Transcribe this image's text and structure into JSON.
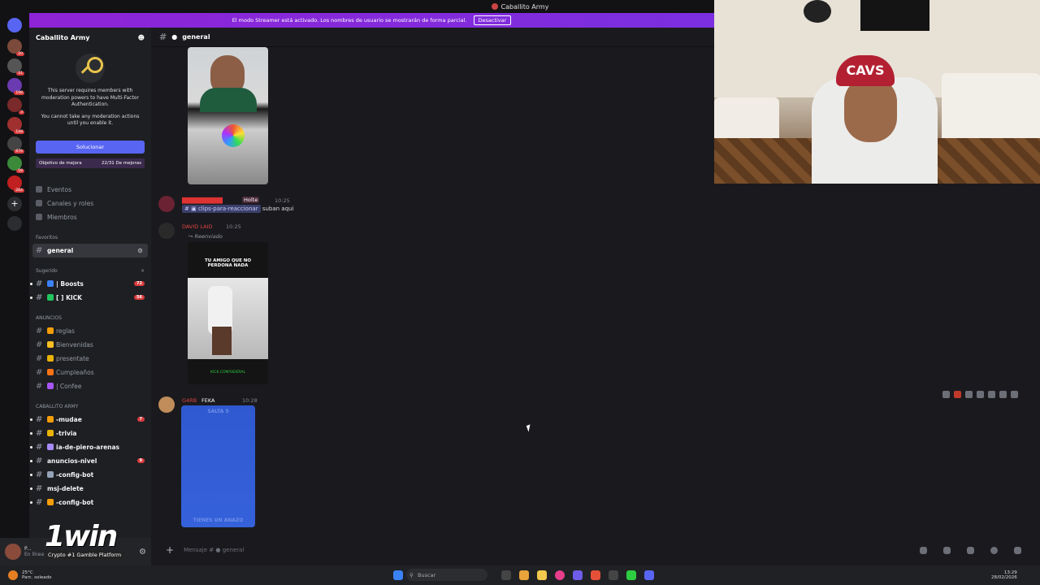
{
  "window": {
    "title": "Caballito Army"
  },
  "streamer_banner": {
    "text": "El modo Streamer está activado. Los nombres de usuario se mostrarán de forma parcial.",
    "button": "Desactivar"
  },
  "server_rail": [
    {
      "badge": "20"
    },
    {
      "badge": "41"
    },
    {
      "badge": "198"
    },
    {
      "badge": "3"
    },
    {
      "badge": "148"
    },
    {
      "badge": "676"
    },
    {
      "badge": "58"
    },
    {
      "badge": "264"
    }
  ],
  "sidebar": {
    "server_name": "Caballito Army",
    "mfa_text1": "This server requires members with moderation powers to have Multi-Factor Authentication.",
    "mfa_text2": "You cannot take any moderation actions until you enable it.",
    "solve_button": "Solucionar",
    "boost_label": "Objetivo de mejora",
    "boost_progress": "22/31 De mejoras",
    "nav": [
      "Eventos",
      "Canales y roles",
      "Miembros"
    ],
    "favorites_label": "Favoritos",
    "active_channel": "general",
    "suggested_label": "Sugerido",
    "suggested": [
      {
        "name": "| Boosts",
        "count": "72"
      },
      {
        "name": "[ ] KICK",
        "count": "56"
      }
    ],
    "announcements_label": "ANUNCIOS",
    "announcements": [
      "reglas",
      "Bienvenidas",
      "presentate",
      "Cumpleaños",
      "| Confee"
    ],
    "army_label": "CABALLITO ARMY",
    "army": [
      {
        "name": "-mudae",
        "count": "7"
      },
      {
        "name": "-trivia",
        "count": ""
      },
      {
        "name": "ia-de-piero-arenas",
        "count": ""
      },
      {
        "name": "anuncios-nivel",
        "count": "9"
      },
      {
        "name": "-config-bot",
        "count": ""
      },
      {
        "name": "msj-delete",
        "count": ""
      },
      {
        "name": "-config-bot",
        "count": ""
      }
    ]
  },
  "userbar": {
    "name": "P...",
    "status": "En línea"
  },
  "promo": {
    "logo": "1win",
    "tagline": "Crypto #1 Gamble Platform"
  },
  "chat": {
    "channel": "general",
    "messages": [
      {
        "time": "10:25",
        "tag": "Holte",
        "channel_chip": "clips-para-reaccionar",
        "text": "suban aqui"
      },
      {
        "user": "DAVID LAID",
        "time": "10:25",
        "forwarded": "Reenviado",
        "video_caption": "TU AMIGO QUE NO PERDONA NADA",
        "video_footer": "KICK.COM/SIDERAL"
      },
      {
        "user": "G4RB",
        "tag": "FEKA",
        "time": "10:28",
        "video_top": "SALTA 5",
        "video_bottom": "TIENES UN ANAZO"
      }
    ],
    "input_placeholder": "Mensaje #",
    "input_channel": "general"
  },
  "taskbar": {
    "weather": "25°C",
    "weather_desc": "Parc. soleado",
    "search": "Buscar",
    "time": "13:29",
    "date": "28/02/2026"
  }
}
